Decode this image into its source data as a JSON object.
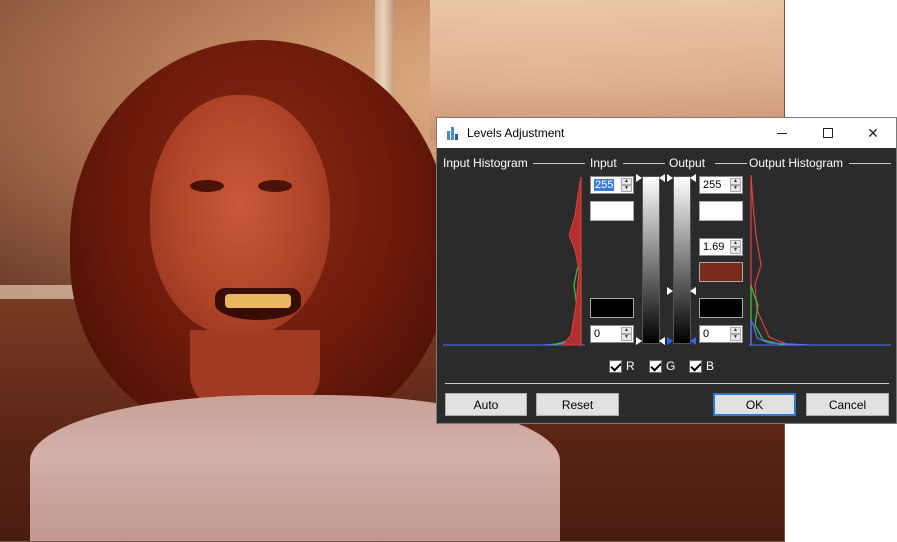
{
  "dialog": {
    "title": "Levels Adjustment",
    "sections": {
      "input_histogram": "Input Histogram",
      "input": "Input",
      "output": "Output",
      "output_histogram": "Output Histogram"
    },
    "input_high": "255",
    "input_low": "0",
    "output_high": "255",
    "output_gamma": "1.69",
    "output_low": "0",
    "gamma_swatch_color": "#7a2a1a",
    "channels": [
      {
        "label": "R",
        "checked": true
      },
      {
        "label": "G",
        "checked": true
      },
      {
        "label": "B",
        "checked": true
      }
    ],
    "buttons": {
      "auto": "Auto",
      "reset": "Reset",
      "ok": "OK",
      "cancel": "Cancel"
    }
  },
  "colors": {
    "dialog_bg": "#2b2b2b",
    "accent": "#2a78d8",
    "histogram_red": "#e04040",
    "histogram_green": "#40c040",
    "histogram_blue": "#5070ff"
  },
  "icons": {
    "app": "levels-chart-icon",
    "minimize": "minimize-icon",
    "maximize": "maximize-icon",
    "close": "close-icon"
  }
}
